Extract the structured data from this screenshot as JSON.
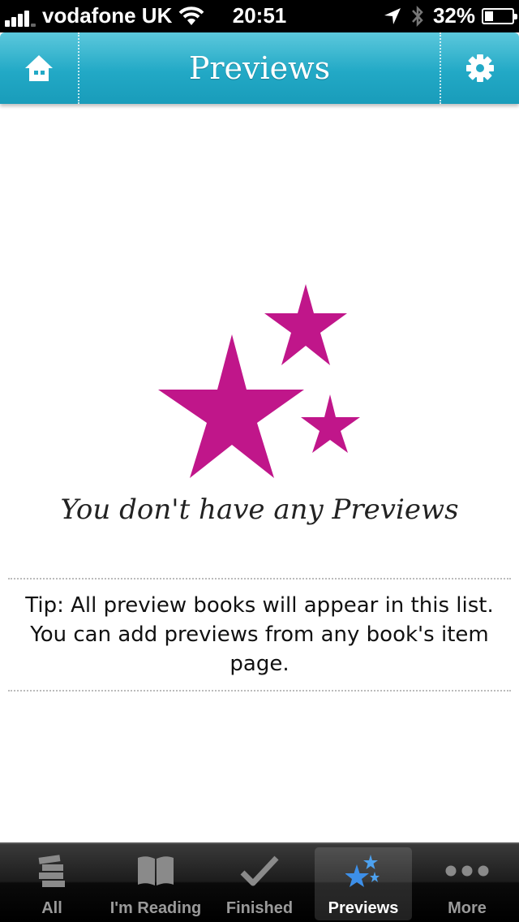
{
  "status_bar": {
    "carrier": "vodafone UK",
    "time": "20:51",
    "battery": "32%",
    "battery_level": 0.32
  },
  "nav": {
    "title": "Previews",
    "left_icon": "home-icon",
    "right_icon": "gear-icon"
  },
  "empty_state": {
    "icon": "stars-icon",
    "icon_color": "#c0168a",
    "message": "You don't have any Previews",
    "tip": "Tip: All preview books will appear in this list. You can add previews from any book's item page."
  },
  "tabs": [
    {
      "label": "All",
      "icon": "books-stack-icon"
    },
    {
      "label": "I'm Reading",
      "icon": "open-book-icon"
    },
    {
      "label": "Finished",
      "icon": "checkmark-icon"
    },
    {
      "label": "Previews",
      "icon": "stars-icon",
      "active": true
    },
    {
      "label": "More",
      "icon": "more-dots-icon"
    }
  ],
  "colors": {
    "nav_accent": "#22a9c6",
    "star": "#c0168a",
    "active_tab_icon": "#3d8fe8"
  }
}
